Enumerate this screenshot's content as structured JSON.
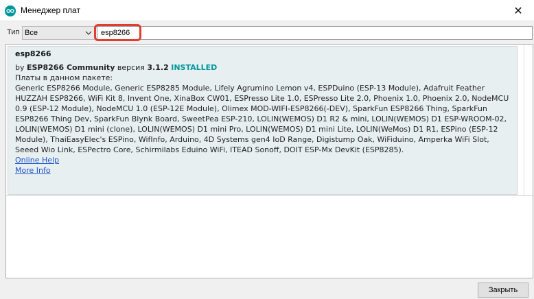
{
  "window": {
    "title": "Менеджер плат",
    "close_glyph": "✕"
  },
  "filter": {
    "type_label": "Тип",
    "type_value": "Все",
    "search_value": "esp8266"
  },
  "package": {
    "name": "esp8266",
    "by": "by",
    "author": "ESP8266 Community",
    "version_label": "версия",
    "version": "3.1.2",
    "status": "INSTALLED",
    "boards_heading": "Платы в данном пакете:",
    "boards_text": "Generic ESP8266 Module, Generic ESP8285 Module, Lifely Agrumino Lemon v4, ESPDuino (ESP-13 Module), Adafruit Feather HUZZAH ESP8266, WiFi Kit 8, Invent One, XinaBox CW01, ESPresso Lite 1.0, ESPresso Lite 2.0, Phoenix 1.0, Phoenix 2.0, NodeMCU 0.9 (ESP-12 Module), NodeMCU 1.0 (ESP-12E Module), Olimex MOD-WIFI-ESP8266(-DEV), SparkFun ESP8266 Thing, SparkFun ESP8266 Thing Dev, SparkFun Blynk Board, SweetPea ESP-210, LOLIN(WEMOS) D1 R2 & mini, LOLIN(WEMOS) D1 ESP-WROOM-02, LOLIN(WEMOS) D1 mini (clone), LOLIN(WEMOS) D1 mini Pro, LOLIN(WEMOS) D1 mini Lite, LOLIN(WeMos) D1 R1, ESPino (ESP-12 Module), ThaiEasyElec's ESPino, WifInfo, Arduino, 4D Systems gen4 IoD Range, Digistump Oak, WiFiduino, Amperka WiFi Slot, Seeed Wio Link, ESPectro Core, Schirmilabs Eduino WiFi, ITEAD Sonoff, DOIT ESP-Mx DevKit (ESP8285).",
    "online_help": "Online Help",
    "more_info": "More Info"
  },
  "footer": {
    "close_label": "Закрыть"
  },
  "colors": {
    "accent": "#00979c",
    "highlight": "#e23b30",
    "link": "#1d55c9"
  },
  "icons": {
    "app": "arduino-icon",
    "dropdown": "chevron-down-icon",
    "close": "close-icon"
  }
}
